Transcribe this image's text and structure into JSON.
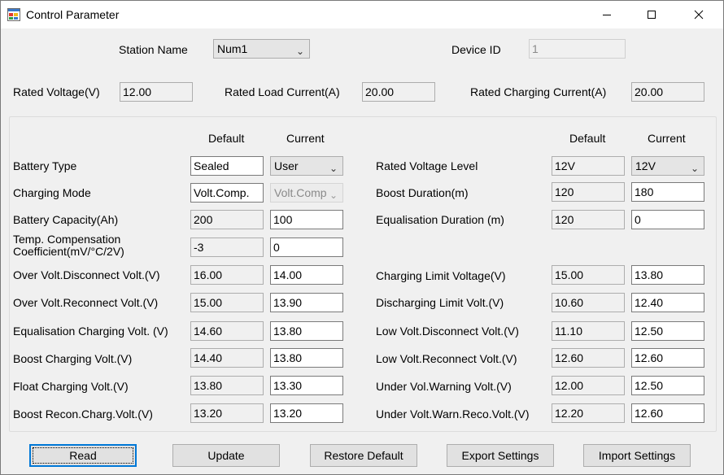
{
  "window": {
    "title": "Control Parameter",
    "minimize": "—",
    "maximize": "☐",
    "close": "✕"
  },
  "header": {
    "station_name_label": "Station Name",
    "station_name_value": "Num1",
    "device_id_label": "Device ID",
    "device_id_value": "1",
    "rated_voltage_label": "Rated Voltage(V)",
    "rated_voltage_value": "12.00",
    "rated_load_current_label": "Rated Load Current(A)",
    "rated_load_current_value": "20.00",
    "rated_charging_current_label": "Rated Charging Current(A)",
    "rated_charging_current_value": "20.00"
  },
  "columns": {
    "default": "Default",
    "current": "Current"
  },
  "left_params": [
    {
      "label": "Battery Type",
      "default": "Sealed",
      "current": "User"
    },
    {
      "label": "Charging Mode",
      "default": "Volt.Comp.",
      "current": "Volt.Comp"
    },
    {
      "label": "Battery Capacity(Ah)",
      "default": "200",
      "current": "100"
    },
    {
      "label": "Temp. Compensation",
      "label2": "Coefficient(mV/°C/2V)",
      "default": "-3",
      "current": "0"
    },
    {
      "label": "Over Volt.Disconnect Volt.(V)",
      "default": "16.00",
      "current": "14.00"
    },
    {
      "label": "Over Volt.Reconnect Volt.(V)",
      "default": "15.00",
      "current": "13.90"
    },
    {
      "label": "Equalisation Charging Volt. (V)",
      "default": "14.60",
      "current": "13.80"
    },
    {
      "label": "Boost Charging Volt.(V)",
      "default": "14.40",
      "current": "13.80"
    },
    {
      "label": "Float Charging Volt.(V)",
      "default": "13.80",
      "current": "13.30"
    },
    {
      "label": "Boost Recon.Charg.Volt.(V)",
      "default": "13.20",
      "current": "13.20"
    }
  ],
  "right_params": [
    {
      "label": "Rated Voltage Level",
      "default": "12V",
      "current": "12V"
    },
    {
      "label": "Boost Duration(m)",
      "default": "120",
      "current": "180"
    },
    {
      "label": "Equalisation Duration (m)",
      "default": "120",
      "current": "0"
    },
    {
      "label": "Charging Limit Voltage(V)",
      "default": "15.00",
      "current": "13.80"
    },
    {
      "label": "Discharging Limit Volt.(V)",
      "default": "10.60",
      "current": "12.40"
    },
    {
      "label": "Low Volt.Disconnect Volt.(V)",
      "default": "11.10",
      "current": "12.50"
    },
    {
      "label": "Low Volt.Reconnect Volt.(V)",
      "default": "12.60",
      "current": "12.60"
    },
    {
      "label": "Under Vol.Warning Volt.(V)",
      "default": "12.00",
      "current": "12.50"
    },
    {
      "label": "Under Volt.Warn.Reco.Volt.(V)",
      "default": "12.20",
      "current": "12.60"
    }
  ],
  "buttons": {
    "read": "Read",
    "update": "Update",
    "restore_default": "Restore Default",
    "export_settings": "Export Settings",
    "import_settings": "Import Settings"
  },
  "icons": {
    "app": "app-window-icon",
    "dropdown": "chevron-down-icon"
  }
}
